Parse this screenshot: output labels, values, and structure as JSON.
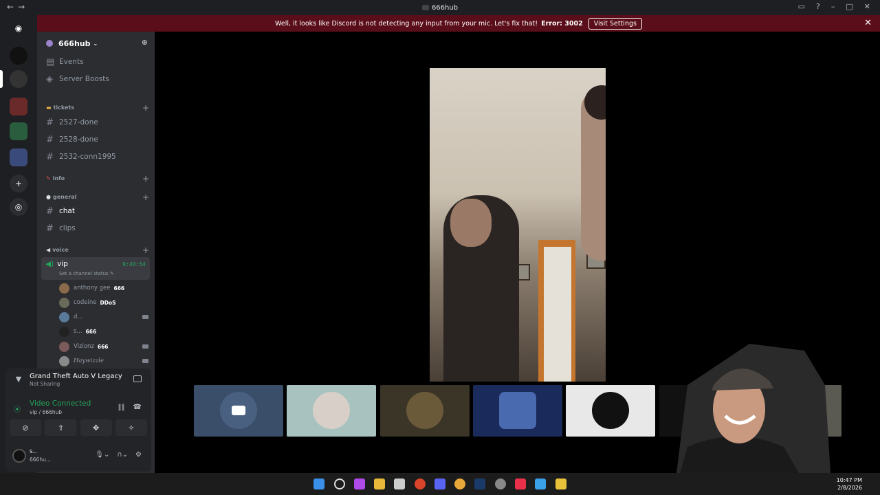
{
  "window": {
    "title": "666hub",
    "nav_back": "←",
    "nav_fwd": "→"
  },
  "banner": {
    "message": "Well, it looks like Discord is not detecting any input from your mic. Let's fix that!",
    "error": "Error: 3002",
    "button": "Visit Settings"
  },
  "server": {
    "name": "666hub"
  },
  "sidebar": {
    "top_items": [
      {
        "label": "Events"
      },
      {
        "label": "Server Boosts"
      }
    ],
    "categories": {
      "tickets": "tickets",
      "info": "info",
      "general": "general",
      "voice": "voice"
    },
    "ticket_channels": [
      "2527-done",
      "2528-done",
      "2532-conn1995"
    ],
    "general_channels": [
      "chat",
      "clips"
    ],
    "voice_channel": {
      "name": "vip",
      "time": "9:40:54",
      "status": "Set a channel status"
    },
    "members": [
      {
        "name": "anthony gee",
        "tag": "666"
      },
      {
        "name": "codeine",
        "tag": "DDoS"
      },
      {
        "name": "d...",
        "tag": ""
      },
      {
        "name": "s...",
        "tag": "666"
      },
      {
        "name": "Vizionz",
        "tag": "666"
      },
      {
        "name": "Haywizzle",
        "tag": ""
      }
    ]
  },
  "activity": {
    "game": "Grand Theft Auto V Legacy",
    "sub": "Not Sharing"
  },
  "connection": {
    "title": "Video Connected",
    "sub": "vip / 666hub"
  },
  "user": {
    "name": "S...",
    "status": "666hu..."
  },
  "taskbar": {
    "time": "10:47 PM",
    "date": "2/8/2026"
  },
  "colors": {
    "banner": "#5a0e19",
    "online": "#23a55a",
    "sidebar": "#2b2d31",
    "rail": "#1e1f22"
  }
}
